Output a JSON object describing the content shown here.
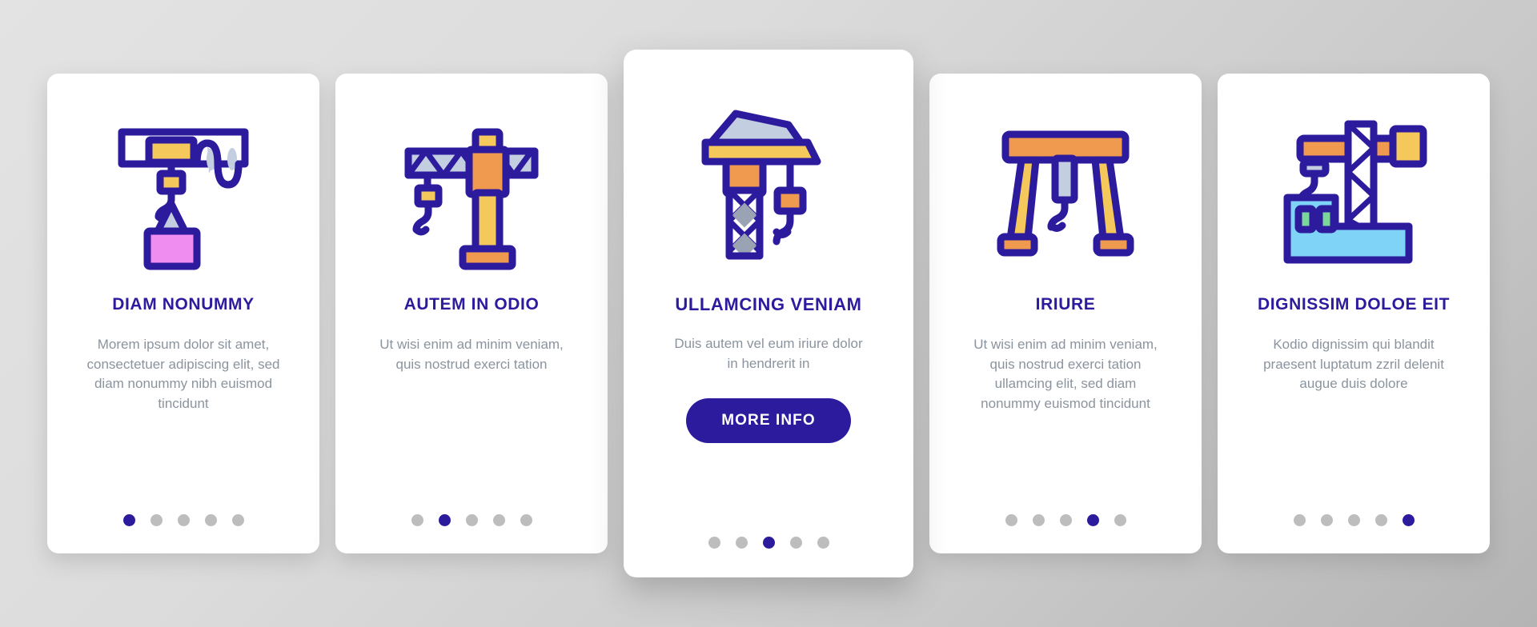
{
  "theme": {
    "background_start": "#e3e3e3",
    "background_end": "#b4b4b4",
    "card_background": "#ffffff",
    "accent": "#2d1b9e",
    "title_color": "#2d1b9e",
    "body_color": "#8b949e",
    "dot_inactive": "#bdbdbd",
    "dot_active": "#2d1b9e",
    "icon_outline": "#2d1b9e",
    "icon_yellow": "#f5c85c",
    "icon_orange": "#ef9a4e",
    "icon_pink": "#ef8ef0",
    "icon_blue_light": "#7fd3f7",
    "icon_blue_pale": "#c3cee0",
    "icon_green": "#7ad69b",
    "icon_gray": "#9aa3b4"
  },
  "cards": [
    {
      "icon": "overhead-hoist-crane-icon",
      "title": "DIAM NONUMMY",
      "body": "Morem ipsum dolor sit amet, consectetuer adipiscing elit, sed diam nonummy nibh euismod tincidunt",
      "dots": {
        "count": 5,
        "active_index": 0
      },
      "featured": false,
      "button": null
    },
    {
      "icon": "tower-jib-crane-icon",
      "title": "AUTEM IN ODIO",
      "body": "Ut wisi enim ad minim veniam, quis nostrud exerci tation",
      "dots": {
        "count": 5,
        "active_index": 1
      },
      "featured": false,
      "button": null
    },
    {
      "icon": "construction-tower-crane-icon",
      "title": "ULLAMCING VENIAM",
      "body": "Duis autem vel eum iriure dolor in hendrerit in",
      "dots": {
        "count": 5,
        "active_index": 2
      },
      "featured": true,
      "button": {
        "label": "MORE INFO"
      }
    },
    {
      "icon": "gantry-crane-icon",
      "title": "IRIURE",
      "body": "Ut wisi enim ad minim veniam, quis nostrud exerci tation ullamcing elit, sed diam nonummy euismod tincidunt",
      "dots": {
        "count": 5,
        "active_index": 3
      },
      "featured": false,
      "button": null
    },
    {
      "icon": "crane-building-site-icon",
      "title": "DIGNISSIM DOLOE EIT",
      "body": "Kodio dignissim qui blandit praesent luptatum zzril delenit augue duis dolore",
      "dots": {
        "count": 5,
        "active_index": 4
      },
      "featured": false,
      "button": null
    }
  ]
}
